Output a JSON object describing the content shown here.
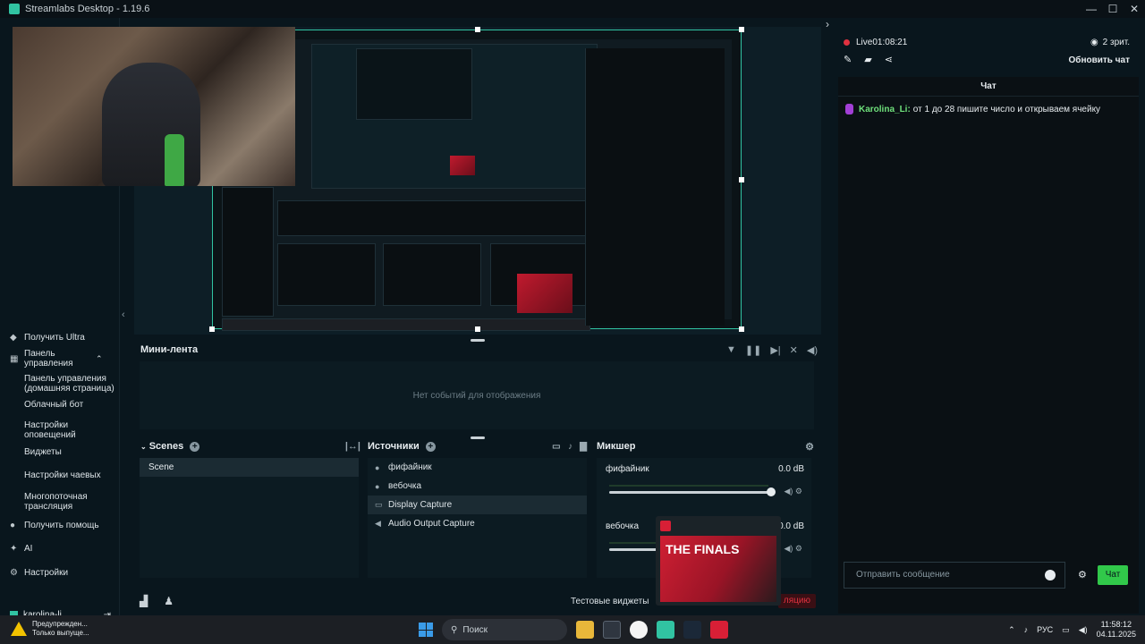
{
  "window": {
    "title": "Streamlabs Desktop - 1.19.6"
  },
  "sidebar": {
    "items": [
      {
        "label": "Получить Ultra",
        "icon": "ultra-icon"
      },
      {
        "label": "Панель управления",
        "icon": "dashboard-icon"
      }
    ],
    "subitems": [
      "Панель управления (домашняя страница)",
      "Облачный бот",
      "Настройки оповещений",
      "Виджеты",
      "Настройки чаевых",
      "Многопоточная трансляция"
    ],
    "bottom_items": [
      {
        "label": "Получить помощь",
        "icon": "help-icon"
      },
      {
        "label": "AI",
        "icon": "ai-icon"
      },
      {
        "label": "Настройки",
        "icon": "gear-icon"
      }
    ],
    "user": "karolina-li"
  },
  "minifeed": {
    "title": "Мини-лента",
    "empty": "Нет событий для отображения"
  },
  "scenes": {
    "title": "Scenes",
    "items": [
      "Scene"
    ]
  },
  "sources": {
    "title": "Источники",
    "items": [
      {
        "label": "фифайник",
        "icon": "mic-icon"
      },
      {
        "label": "вебочка",
        "icon": "mic-icon"
      },
      {
        "label": "Display Capture",
        "icon": "monitor-icon",
        "selected": true
      },
      {
        "label": "Audio Output Capture",
        "icon": "speaker-icon"
      }
    ]
  },
  "mixer": {
    "title": "Микшер",
    "channels": [
      {
        "name": "фифайник",
        "db": "0.0 dB"
      },
      {
        "name": "вебочка",
        "db": "0.0 dB"
      }
    ]
  },
  "status": {
    "test_widgets": "Тестовые виджеты",
    "end_stream": "ляцию"
  },
  "popup": {
    "game_title": "THE FINALS"
  },
  "chat": {
    "live_label": "Live",
    "live_time": "01:08:21",
    "viewers": "2 зрит.",
    "refresh": "Обновить чат",
    "title": "Чат",
    "messages": [
      {
        "author": "Karolina_Li:",
        "text": "от 1 до 28 пишите число и открываем ячейку"
      }
    ],
    "input_placeholder": "Отправить сообщение",
    "send": "Чат"
  },
  "taskbar": {
    "warning_title": "Предупрежден...",
    "warning_text": "Только выпуще...",
    "search": "Поиск",
    "lang": "РУС",
    "time": "11:58:12",
    "date": "04.11.2025"
  },
  "colors": {
    "accent": "#31c3a2",
    "live": "#e0313f",
    "send": "#31c84a"
  }
}
